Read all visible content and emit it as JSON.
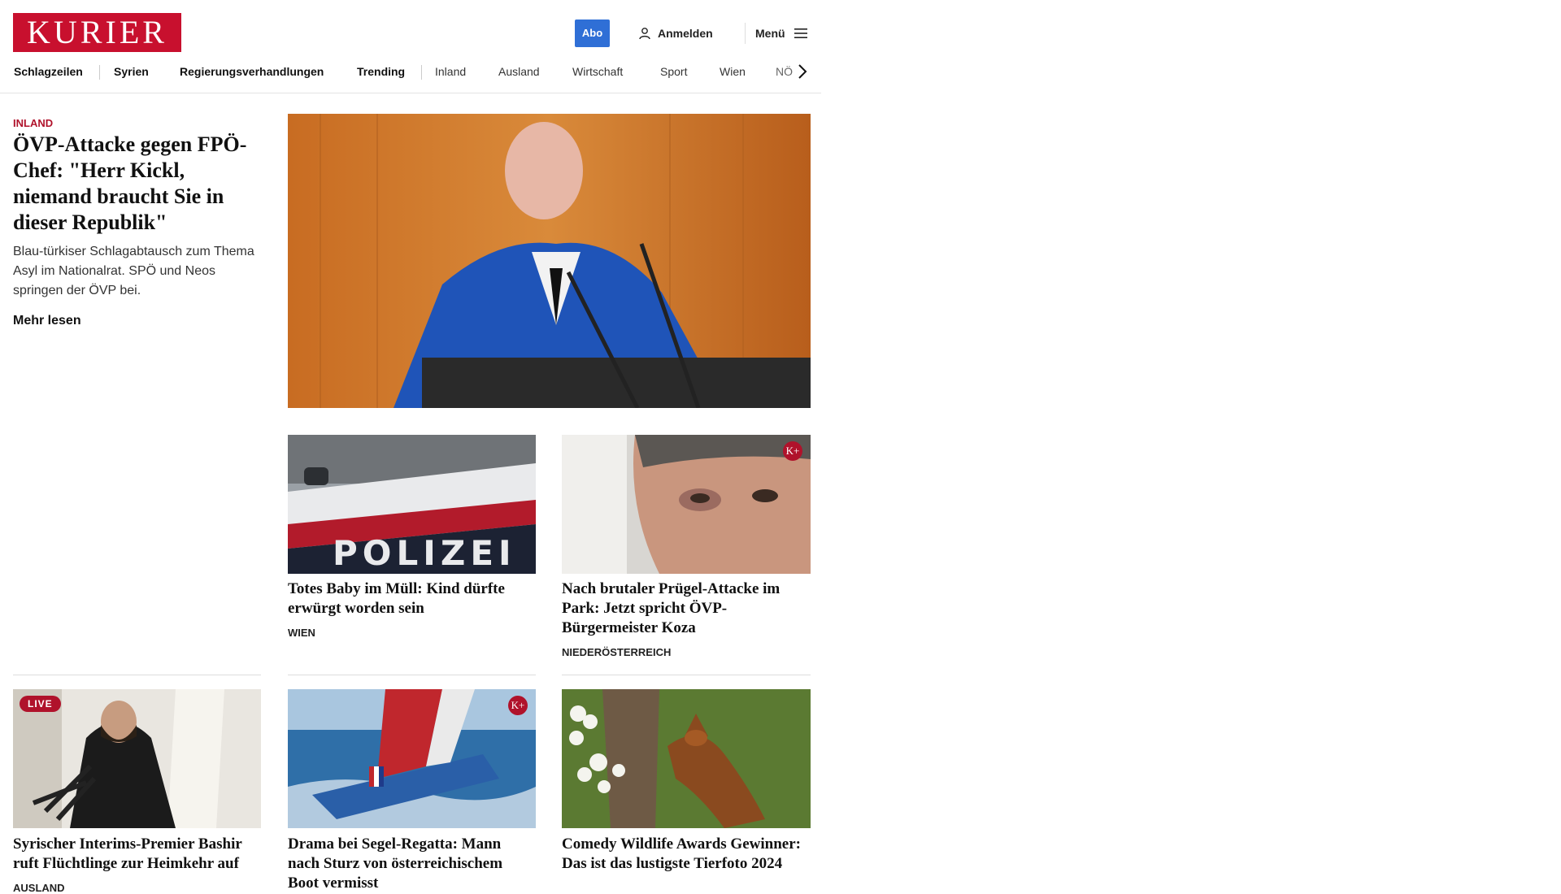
{
  "header": {
    "logo_text": "KURIER",
    "abo_label": "Abo",
    "login_label": "Anmelden",
    "menu_label": "Menü"
  },
  "nav": {
    "items": [
      "Schlagzeilen",
      "Syrien",
      "Regierungsverhandlungen",
      "Trending",
      "Inland",
      "Ausland",
      "Wirtschaft",
      "Sport",
      "Wien",
      "NÖ"
    ]
  },
  "lead": {
    "kicker": "INLAND",
    "title": "ÖVP-Attacke gegen FPÖ-Chef: \"Herr Kickl, niemand braucht Sie in dieser Republik\"",
    "teaser": "Blau-türkiser Schlagabtausch zum Thema Asyl im Nationalrat. SPÖ und Neos springen der ÖVP bei.",
    "more_label": "Mehr lesen"
  },
  "cards_row1": [
    {
      "title": "Totes Baby im Müll: Kind dürfte erwürgt worden sein",
      "ressort": "WIEN",
      "image_text": "POLIZEI"
    },
    {
      "title": "Nach brutaler Prügel-Attacke im Park: Jetzt spricht ÖVP-Bürgermeister Koza",
      "ressort": "NIEDERÖSTERREICH",
      "badge": "K+"
    }
  ],
  "cards_row2": [
    {
      "title": "Syrischer Interims-Premier Bashir ruft Flüchtlinge zur Heimkehr auf",
      "ressort": "AUSLAND",
      "badge": "LIVE"
    },
    {
      "title": "Drama bei Segel-Regatta: Mann nach Sturz von österreichischem Boot vermisst",
      "ressort": "",
      "badge": "K+"
    },
    {
      "title": "Comedy Wildlife Awards Gewinner: Das ist das lustigste Tierfoto 2024",
      "ressort": ""
    }
  ],
  "colors": {
    "brand": "#c8102e",
    "accent": "#b0122b",
    "abo_button": "#2f6fd6"
  }
}
